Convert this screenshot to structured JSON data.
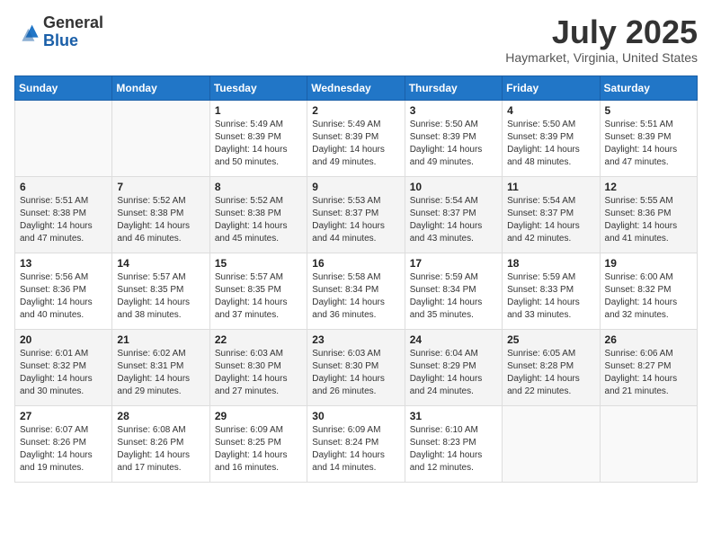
{
  "header": {
    "logo_general": "General",
    "logo_blue": "Blue",
    "month_year": "July 2025",
    "location": "Haymarket, Virginia, United States"
  },
  "days_of_week": [
    "Sunday",
    "Monday",
    "Tuesday",
    "Wednesday",
    "Thursday",
    "Friday",
    "Saturday"
  ],
  "weeks": [
    [
      {
        "day": "",
        "sunrise": "",
        "sunset": "",
        "daylight": "",
        "empty": true
      },
      {
        "day": "",
        "sunrise": "",
        "sunset": "",
        "daylight": "",
        "empty": true
      },
      {
        "day": "1",
        "sunrise": "Sunrise: 5:49 AM",
        "sunset": "Sunset: 8:39 PM",
        "daylight": "Daylight: 14 hours and 50 minutes.",
        "empty": false
      },
      {
        "day": "2",
        "sunrise": "Sunrise: 5:49 AM",
        "sunset": "Sunset: 8:39 PM",
        "daylight": "Daylight: 14 hours and 49 minutes.",
        "empty": false
      },
      {
        "day": "3",
        "sunrise": "Sunrise: 5:50 AM",
        "sunset": "Sunset: 8:39 PM",
        "daylight": "Daylight: 14 hours and 49 minutes.",
        "empty": false
      },
      {
        "day": "4",
        "sunrise": "Sunrise: 5:50 AM",
        "sunset": "Sunset: 8:39 PM",
        "daylight": "Daylight: 14 hours and 48 minutes.",
        "empty": false
      },
      {
        "day": "5",
        "sunrise": "Sunrise: 5:51 AM",
        "sunset": "Sunset: 8:39 PM",
        "daylight": "Daylight: 14 hours and 47 minutes.",
        "empty": false
      }
    ],
    [
      {
        "day": "6",
        "sunrise": "Sunrise: 5:51 AM",
        "sunset": "Sunset: 8:38 PM",
        "daylight": "Daylight: 14 hours and 47 minutes.",
        "empty": false
      },
      {
        "day": "7",
        "sunrise": "Sunrise: 5:52 AM",
        "sunset": "Sunset: 8:38 PM",
        "daylight": "Daylight: 14 hours and 46 minutes.",
        "empty": false
      },
      {
        "day": "8",
        "sunrise": "Sunrise: 5:52 AM",
        "sunset": "Sunset: 8:38 PM",
        "daylight": "Daylight: 14 hours and 45 minutes.",
        "empty": false
      },
      {
        "day": "9",
        "sunrise": "Sunrise: 5:53 AM",
        "sunset": "Sunset: 8:37 PM",
        "daylight": "Daylight: 14 hours and 44 minutes.",
        "empty": false
      },
      {
        "day": "10",
        "sunrise": "Sunrise: 5:54 AM",
        "sunset": "Sunset: 8:37 PM",
        "daylight": "Daylight: 14 hours and 43 minutes.",
        "empty": false
      },
      {
        "day": "11",
        "sunrise": "Sunrise: 5:54 AM",
        "sunset": "Sunset: 8:37 PM",
        "daylight": "Daylight: 14 hours and 42 minutes.",
        "empty": false
      },
      {
        "day": "12",
        "sunrise": "Sunrise: 5:55 AM",
        "sunset": "Sunset: 8:36 PM",
        "daylight": "Daylight: 14 hours and 41 minutes.",
        "empty": false
      }
    ],
    [
      {
        "day": "13",
        "sunrise": "Sunrise: 5:56 AM",
        "sunset": "Sunset: 8:36 PM",
        "daylight": "Daylight: 14 hours and 40 minutes.",
        "empty": false
      },
      {
        "day": "14",
        "sunrise": "Sunrise: 5:57 AM",
        "sunset": "Sunset: 8:35 PM",
        "daylight": "Daylight: 14 hours and 38 minutes.",
        "empty": false
      },
      {
        "day": "15",
        "sunrise": "Sunrise: 5:57 AM",
        "sunset": "Sunset: 8:35 PM",
        "daylight": "Daylight: 14 hours and 37 minutes.",
        "empty": false
      },
      {
        "day": "16",
        "sunrise": "Sunrise: 5:58 AM",
        "sunset": "Sunset: 8:34 PM",
        "daylight": "Daylight: 14 hours and 36 minutes.",
        "empty": false
      },
      {
        "day": "17",
        "sunrise": "Sunrise: 5:59 AM",
        "sunset": "Sunset: 8:34 PM",
        "daylight": "Daylight: 14 hours and 35 minutes.",
        "empty": false
      },
      {
        "day": "18",
        "sunrise": "Sunrise: 5:59 AM",
        "sunset": "Sunset: 8:33 PM",
        "daylight": "Daylight: 14 hours and 33 minutes.",
        "empty": false
      },
      {
        "day": "19",
        "sunrise": "Sunrise: 6:00 AM",
        "sunset": "Sunset: 8:32 PM",
        "daylight": "Daylight: 14 hours and 32 minutes.",
        "empty": false
      }
    ],
    [
      {
        "day": "20",
        "sunrise": "Sunrise: 6:01 AM",
        "sunset": "Sunset: 8:32 PM",
        "daylight": "Daylight: 14 hours and 30 minutes.",
        "empty": false
      },
      {
        "day": "21",
        "sunrise": "Sunrise: 6:02 AM",
        "sunset": "Sunset: 8:31 PM",
        "daylight": "Daylight: 14 hours and 29 minutes.",
        "empty": false
      },
      {
        "day": "22",
        "sunrise": "Sunrise: 6:03 AM",
        "sunset": "Sunset: 8:30 PM",
        "daylight": "Daylight: 14 hours and 27 minutes.",
        "empty": false
      },
      {
        "day": "23",
        "sunrise": "Sunrise: 6:03 AM",
        "sunset": "Sunset: 8:30 PM",
        "daylight": "Daylight: 14 hours and 26 minutes.",
        "empty": false
      },
      {
        "day": "24",
        "sunrise": "Sunrise: 6:04 AM",
        "sunset": "Sunset: 8:29 PM",
        "daylight": "Daylight: 14 hours and 24 minutes.",
        "empty": false
      },
      {
        "day": "25",
        "sunrise": "Sunrise: 6:05 AM",
        "sunset": "Sunset: 8:28 PM",
        "daylight": "Daylight: 14 hours and 22 minutes.",
        "empty": false
      },
      {
        "day": "26",
        "sunrise": "Sunrise: 6:06 AM",
        "sunset": "Sunset: 8:27 PM",
        "daylight": "Daylight: 14 hours and 21 minutes.",
        "empty": false
      }
    ],
    [
      {
        "day": "27",
        "sunrise": "Sunrise: 6:07 AM",
        "sunset": "Sunset: 8:26 PM",
        "daylight": "Daylight: 14 hours and 19 minutes.",
        "empty": false
      },
      {
        "day": "28",
        "sunrise": "Sunrise: 6:08 AM",
        "sunset": "Sunset: 8:26 PM",
        "daylight": "Daylight: 14 hours and 17 minutes.",
        "empty": false
      },
      {
        "day": "29",
        "sunrise": "Sunrise: 6:09 AM",
        "sunset": "Sunset: 8:25 PM",
        "daylight": "Daylight: 14 hours and 16 minutes.",
        "empty": false
      },
      {
        "day": "30",
        "sunrise": "Sunrise: 6:09 AM",
        "sunset": "Sunset: 8:24 PM",
        "daylight": "Daylight: 14 hours and 14 minutes.",
        "empty": false
      },
      {
        "day": "31",
        "sunrise": "Sunrise: 6:10 AM",
        "sunset": "Sunset: 8:23 PM",
        "daylight": "Daylight: 14 hours and 12 minutes.",
        "empty": false
      },
      {
        "day": "",
        "sunrise": "",
        "sunset": "",
        "daylight": "",
        "empty": true
      },
      {
        "day": "",
        "sunrise": "",
        "sunset": "",
        "daylight": "",
        "empty": true
      }
    ]
  ]
}
